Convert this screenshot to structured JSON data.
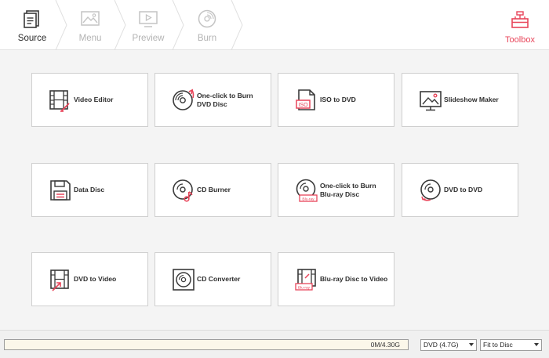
{
  "steps": [
    {
      "label": "Source",
      "icon": "source-icon",
      "active": true
    },
    {
      "label": "Menu",
      "icon": "menu-image-icon",
      "active": false
    },
    {
      "label": "Preview",
      "icon": "preview-icon",
      "active": false
    },
    {
      "label": "Burn",
      "icon": "burn-disc-icon",
      "active": false
    }
  ],
  "toolbox": {
    "label": "Toolbox",
    "icon": "toolbox-icon"
  },
  "tools": [
    {
      "label": "Video Editor",
      "icon": "video-editor-icon"
    },
    {
      "label": "One-click to Burn DVD Disc",
      "icon": "burn-dvd-disc-icon"
    },
    {
      "label": "ISO to DVD",
      "icon": "iso-to-dvd-icon"
    },
    {
      "label": "Slideshow Maker",
      "icon": "slideshow-maker-icon"
    },
    {
      "label": "Data Disc",
      "icon": "data-disc-icon"
    },
    {
      "label": "CD Burner",
      "icon": "cd-burner-icon"
    },
    {
      "label": "One-click to Burn Blu-ray Disc",
      "icon": "burn-bluray-disc-icon"
    },
    {
      "label": "DVD to DVD",
      "icon": "dvd-to-dvd-icon"
    },
    {
      "label": "DVD to Video",
      "icon": "dvd-to-video-icon"
    },
    {
      "label": "CD Converter",
      "icon": "cd-converter-icon"
    },
    {
      "label": "Blu-ray Disc to Video",
      "icon": "bluray-to-video-icon"
    }
  ],
  "footer": {
    "capacity_text": "0M/4.30G",
    "used_fraction": 0,
    "disc_type": "DVD (4.7G)",
    "fit_mode": "Fit to Disc"
  },
  "colors": {
    "accent": "#e8455a",
    "icon_dark": "#3a3a3a",
    "inactive": "#c4c4c4"
  }
}
